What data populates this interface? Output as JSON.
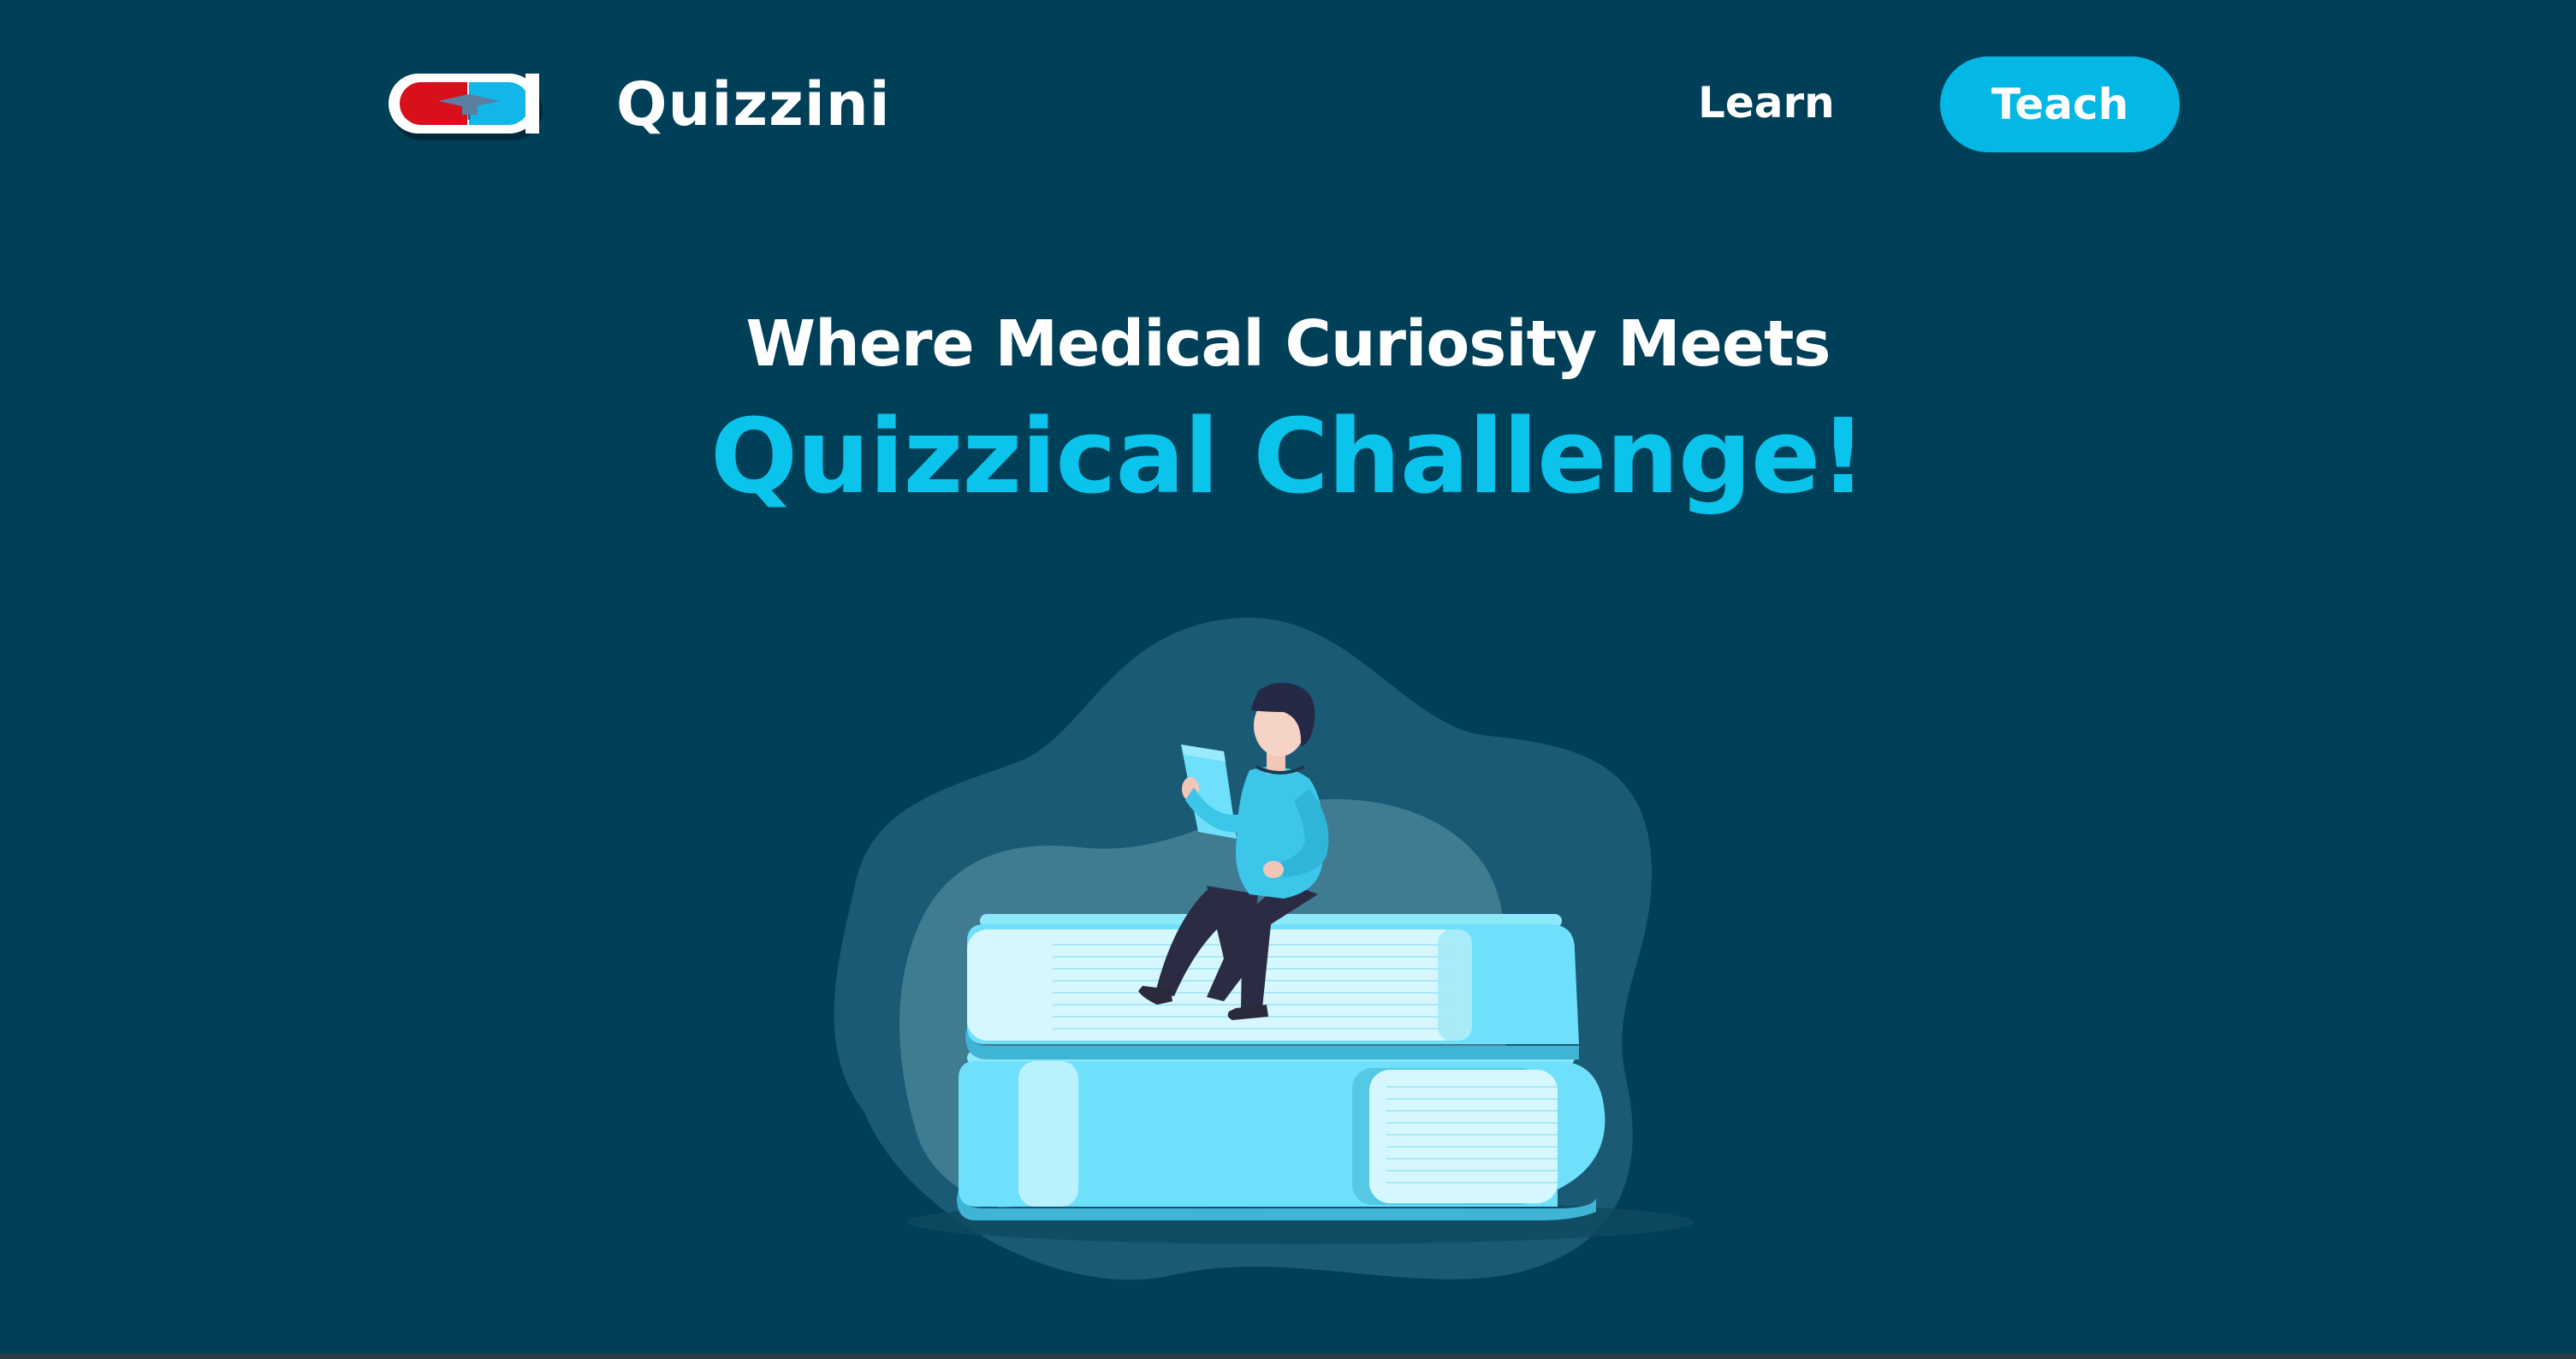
{
  "nav": {
    "brand_name": "Quizzini",
    "learn_label": "Learn",
    "teach_label": "Teach",
    "logo_icon": "pill-graduation-cap-icon"
  },
  "hero": {
    "headline_line1": "Where Medical Curiosity Meets",
    "headline_line2": "Quizzical Challenge!",
    "illustration": "person-reading-on-books-illustration"
  },
  "colors": {
    "background": "#003f58",
    "accent": "#04b8e6",
    "headline_accent": "#0ac4ec",
    "text": "#ffffff",
    "logo_red": "#d8101c",
    "logo_blue": "#12b6e8"
  }
}
